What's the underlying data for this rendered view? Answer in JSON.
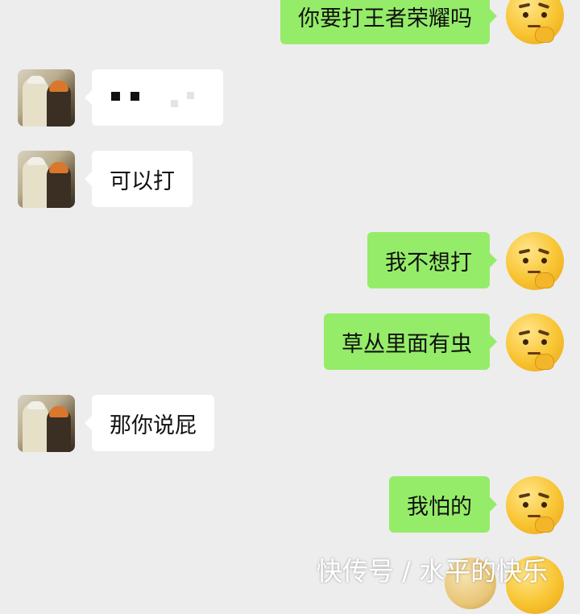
{
  "colors": {
    "background": "#ededed",
    "incoming_bubble": "#ffffff",
    "outgoing_bubble": "#95ec69"
  },
  "messages": [
    {
      "from": "self",
      "text": "你要打王者荣耀吗",
      "avatar": "thinking-face-emoji"
    },
    {
      "from": "friend",
      "text": "",
      "content": "pixelated-censored-text",
      "avatar": "friend-photo"
    },
    {
      "from": "friend",
      "text": "可以打",
      "avatar": "friend-photo"
    },
    {
      "from": "self",
      "text": "我不想打",
      "avatar": "thinking-face-emoji"
    },
    {
      "from": "self",
      "text": "草丛里面有虫",
      "avatar": "thinking-face-emoji"
    },
    {
      "from": "friend",
      "text": "那你说屁",
      "avatar": "friend-photo"
    },
    {
      "from": "self",
      "text": "我怕的",
      "avatar": "thinking-face-emoji"
    }
  ],
  "watermark": "快传号 / 水平的快乐"
}
